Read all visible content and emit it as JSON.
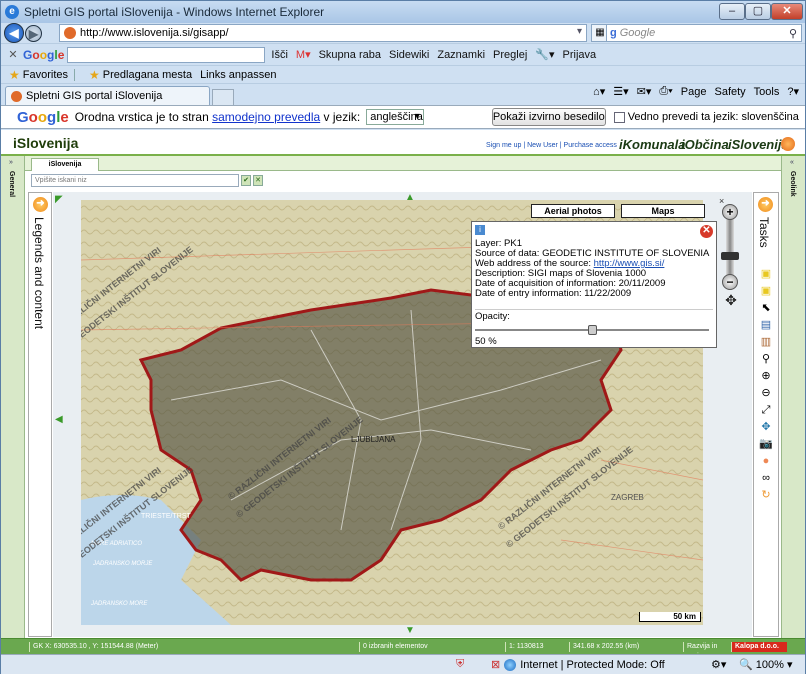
{
  "window": {
    "title": "Spletni GIS portal iSlovenija - Windows Internet Explorer"
  },
  "address": {
    "url": "http://www.islovenija.si/gisapp/",
    "search_placeholder": "Google"
  },
  "google_toolbar": {
    "logo": "Google",
    "search_label": "Išči",
    "items": [
      "Skupna raba",
      "Sidewiki",
      "Zaznamki",
      "Preglej",
      "Prijava"
    ]
  },
  "favorites": {
    "label": "Favorites",
    "items": [
      "Predlagana mesta",
      "Links anpassen"
    ]
  },
  "tab": {
    "label": "Spletni GIS portal iSlovenija"
  },
  "command_bar": [
    "Page",
    "Safety",
    "Tools"
  ],
  "translate_bar": {
    "prefix": "Orodna vrstica je to stran",
    "link": "samodejno prevedla",
    "mid": "v jezik:",
    "language": "angleščina",
    "button": "Pokaži izvirno besedilo",
    "checkbox": "Vedno prevedi ta jezik: slovenščina"
  },
  "app": {
    "title": "iSlovenija",
    "links": "Sign me up | New User | Purchase access",
    "brands": [
      "iKomunala",
      "iObčina",
      "iSlovenija"
    ],
    "side_left": "General",
    "side_right": "Geolink",
    "tab": "iSlovenija",
    "search_placeholder": "Vpišite iskani niz",
    "legends_label": "Legends and content",
    "tasks_label": "Tasks"
  },
  "map": {
    "aerial_button": "Aerial photos",
    "maps_button": "Maps",
    "scale": "50 km",
    "watermark_1": "© RAZLIČNI INTERNETNI VIRI",
    "watermark_2": "© GEODETSKI INŠTITUT SLOVENIJE",
    "labels": [
      "LJUBLJANA",
      "ZAGREB",
      "TRIESTE/TRST",
      "MARE ADRIATICO",
      "JADRANSKO MORJE",
      "JADRANSKO MORE"
    ],
    "colors": {
      "border": "#a01818",
      "overlay": "#4a4a3a",
      "land": "#d8d2a8",
      "sea": "#b8d4ea"
    }
  },
  "info_popup": {
    "layer": "Layer: PK1",
    "source": "Source of data: GEODETIC INSTITUTE OF SLOVENIA",
    "web_label": "Web address of the source:",
    "web_url": "http://www.gis.si/",
    "description": "Description: SIGI maps of Slovenia 1000",
    "acquisition": "Date of acquisition of information: 20/11/2009",
    "entry": "Date of entry information: 11/22/2009",
    "opacity_label": "Opacity:",
    "opacity_value": "50 %",
    "opacity_fraction": 0.5
  },
  "status_app": {
    "coords": "GK X: 630535.10 , Y: 151544.88 (Meter)",
    "selected": "0 izbranih elementov",
    "scale": "1: 1130813",
    "extent": "341.68 x 202.55 (km)",
    "dev": "Razvija in ureja",
    "brand": "Kalopa d.o.o."
  },
  "ie_status": {
    "zone": "Internet | Protected Mode: Off",
    "zoom": "100%"
  }
}
